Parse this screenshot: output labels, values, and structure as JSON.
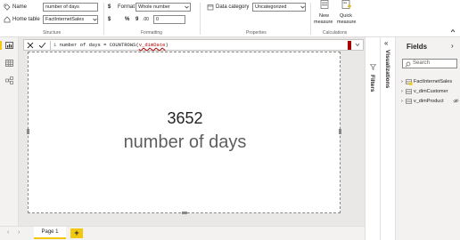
{
  "ribbon": {
    "name_label": "Name",
    "name_value": "number of days",
    "home_table_label": "Home table",
    "home_table_value": "FactInternetSales",
    "structure_label": "Structure",
    "format_label": "Format",
    "format_value": "Whole number",
    "currency_symbol": "$",
    "percent_symbol": "%",
    "comma_symbol": "9",
    "decimal_symbol": ".00",
    "decimal_places": "0",
    "formatting_label": "Formatting",
    "data_category_label": "Data category",
    "data_category_value": "Uncategorized",
    "properties_label": "Properties",
    "new_measure_label_1": "New",
    "new_measure_label_2": "measure",
    "quick_measure_label_1": "Quick",
    "quick_measure_label_2": "measure",
    "calculations_label": "Calculations"
  },
  "formula": {
    "line_number": "1",
    "text_before": "number of days = COUNTROWS(",
    "text_arg": "v_dimDate",
    "text_after": ")"
  },
  "card": {
    "value": "3652",
    "label": "number of days"
  },
  "panes": {
    "visualizations": "Visualizations",
    "filters": "Filters",
    "fields_title": "Fields",
    "search_placeholder": "Search",
    "tables": [
      "FactInternetSales",
      "v_dimCustomer",
      "v_dimProduct"
    ]
  },
  "pages": {
    "tab": "Page 1",
    "add": "+"
  },
  "colors": {
    "accent": "#f2c811",
    "error": "#a80000",
    "link": "#0078d4"
  }
}
